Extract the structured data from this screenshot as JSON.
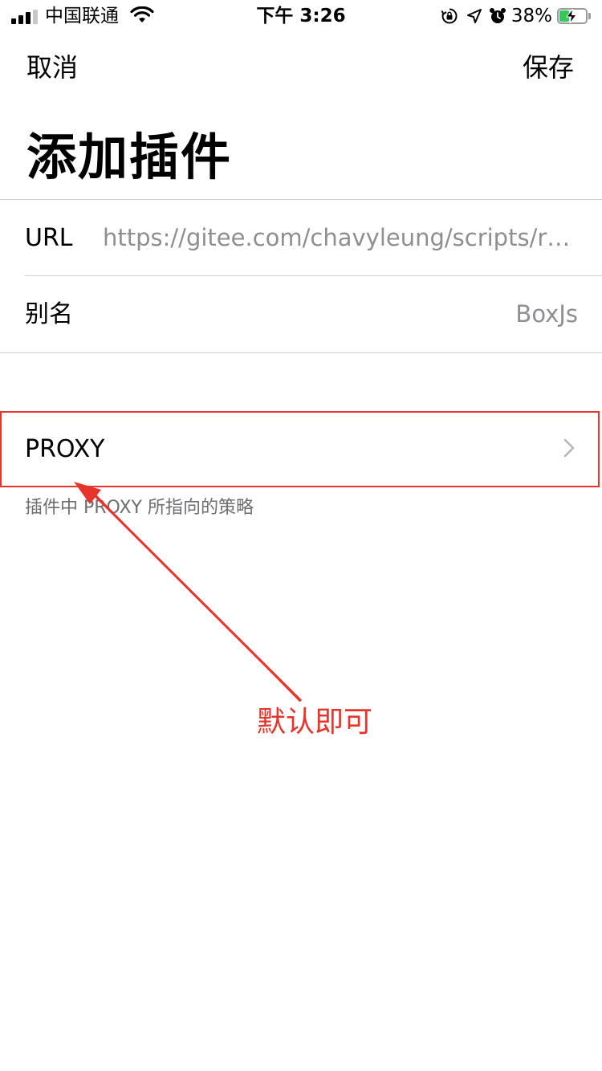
{
  "status_bar": {
    "carrier": "中国联通",
    "time": "下午 3:26",
    "battery_percent": "38%",
    "battery_level": 0.38,
    "signal_bars": 3,
    "icons": [
      "signal-icon",
      "wifi-icon",
      "orientation-lock-icon",
      "location-icon",
      "alarm-icon",
      "battery-icon",
      "charging-bolt-icon"
    ]
  },
  "nav": {
    "cancel_label": "取消",
    "save_label": "保存"
  },
  "page": {
    "title": "添加插件"
  },
  "form": {
    "url_label": "URL",
    "url_value": "https://gitee.com/chavyleung/scripts/raw/…",
    "alias_label": "别名",
    "alias_value": "BoxJs"
  },
  "policy": {
    "label": "PROXY",
    "footnote": "插件中 PROXY 所指向的策略"
  },
  "annotation": {
    "text": "默认即可",
    "color": "#e8352c"
  },
  "colors": {
    "accent_red": "#e8352c",
    "secondary_text": "#8e8e93",
    "battery_green": "#34c759"
  }
}
